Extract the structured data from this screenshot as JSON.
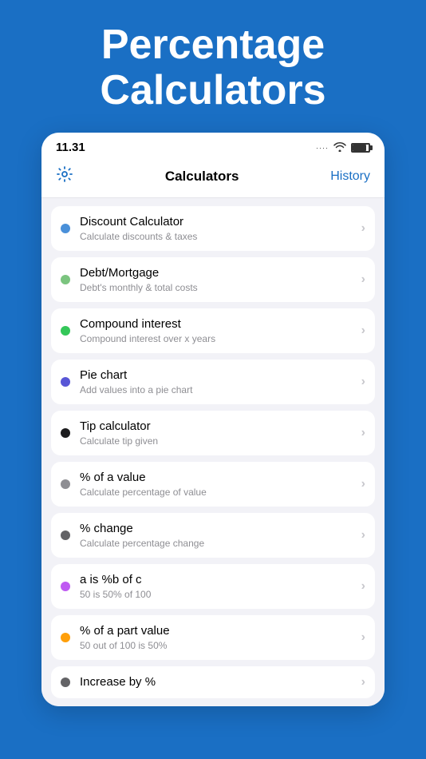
{
  "hero": {
    "title": "Percentage Calculators"
  },
  "statusBar": {
    "time": "11.31",
    "wifi": "wifi",
    "battery": "battery"
  },
  "nav": {
    "settings_label": "⚙",
    "title": "Calculators",
    "history": "History"
  },
  "items": [
    {
      "id": "discount",
      "title": "Discount Calculator",
      "subtitle": "Calculate discounts & taxes",
      "dotColor": "#4a90d9"
    },
    {
      "id": "debt",
      "title": "Debt/Mortgage",
      "subtitle": "Debt's monthly & total costs",
      "dotColor": "#7bc47f"
    },
    {
      "id": "compound",
      "title": "Compound interest",
      "subtitle": "Compound interest over x years",
      "dotColor": "#34c759"
    },
    {
      "id": "piechart",
      "title": "Pie chart",
      "subtitle": "Add values into a pie chart",
      "dotColor": "#5856d6"
    },
    {
      "id": "tip",
      "title": "Tip calculator",
      "subtitle": "Calculate tip given",
      "dotColor": "#1c1c1e"
    },
    {
      "id": "percent-of-value",
      "title": "% of a value",
      "subtitle": "Calculate percentage of value",
      "dotColor": "#8e8e93"
    },
    {
      "id": "percent-change",
      "title": "% change",
      "subtitle": "Calculate percentage change",
      "dotColor": "#636366"
    },
    {
      "id": "ais-b-of-c",
      "title": "a is %b of c",
      "subtitle": "50 is 50% of 100",
      "dotColor": "#bf5af2"
    },
    {
      "id": "percent-of-part",
      "title": "% of a part value",
      "subtitle": "50 out of 100 is 50%",
      "dotColor": "#ff9f0a"
    },
    {
      "id": "increase-by",
      "title": "Increase by %",
      "subtitle": "",
      "dotColor": "#636366"
    }
  ]
}
